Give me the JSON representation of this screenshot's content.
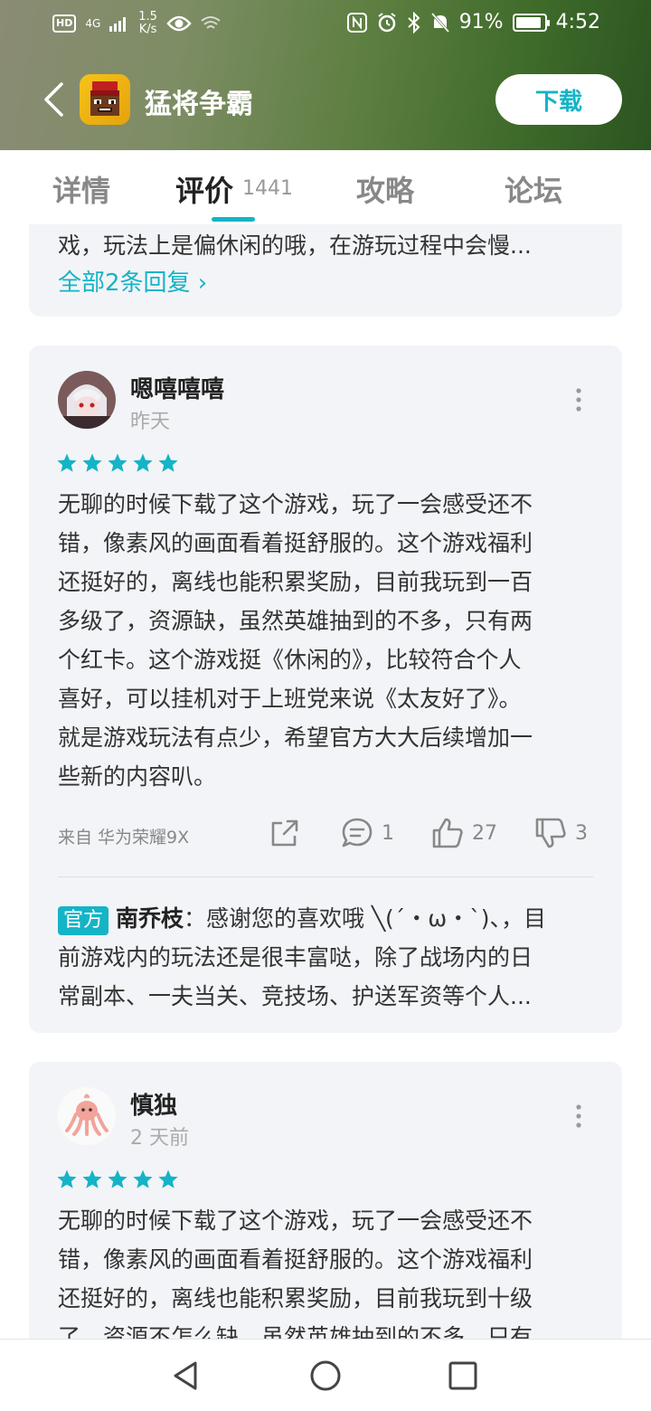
{
  "status_bar": {
    "hd": "HD",
    "network": "4G",
    "speed_value": "1.5",
    "speed_unit": "K/s",
    "battery": "91%",
    "battery_level": 0.91,
    "time": "4:52"
  },
  "header": {
    "app_name": "猛将争霸",
    "download_label": "下载"
  },
  "tabs": {
    "items": [
      "详情",
      "评价",
      "攻略",
      "论坛"
    ],
    "active": "评价",
    "review_count": "1441"
  },
  "partial_card": {
    "text": "戏，玩法上是偏休闲的哦，在游玩过程中会慢...",
    "replies_link": "全部2条回复 ›"
  },
  "reviews": [
    {
      "username": "嗯嘻嘻嘻",
      "date": "昨天",
      "rating": 5,
      "lines": [
        "无聊的时候下载了这个游戏，玩了一会感受还不",
        "错，像素风的画面看着挺舒服的。这个游戏福利",
        "还挺好的，离线也能积累奖励，目前我玩到一百",
        "多级了，资源缺，虽然英雄抽到的不多，只有两",
        "个红卡。这个游戏挺《休闲的》，比较符合个人",
        "喜好，可以挂机对于上班党来说《太友好了》。",
        "就是游戏玩法有点少，希望官方大大后续增加一",
        "些新的内容叭。"
      ],
      "device": "来自 华为荣耀9X",
      "comments": "1",
      "likes": "27",
      "dislikes": "3",
      "reply": {
        "badge": "官方",
        "name": "南乔枝",
        "lines": [
          "：感谢您的喜欢哦 ╲(´・ω・`)、，目",
          "前游戏内的玩法还是很丰富哒，除了战场内的日",
          "常副本、一夫当关、竞技场、护送军资等个人..."
        ]
      }
    },
    {
      "username": "慎独",
      "date": "2 天前",
      "rating": 5,
      "lines": [
        "无聊的时候下载了这个游戏，玩了一会感受还不",
        "错，像素风的画面看着挺舒服的。这个游戏福利",
        "还挺好的，离线也能积累奖励，目前我玩到十级",
        "了，资源不怎么缺，虽然英雄抽到的不多，只有"
      ]
    }
  ],
  "colors": {
    "accent": "#14b4c6",
    "card_bg": "#f3f4f7"
  }
}
